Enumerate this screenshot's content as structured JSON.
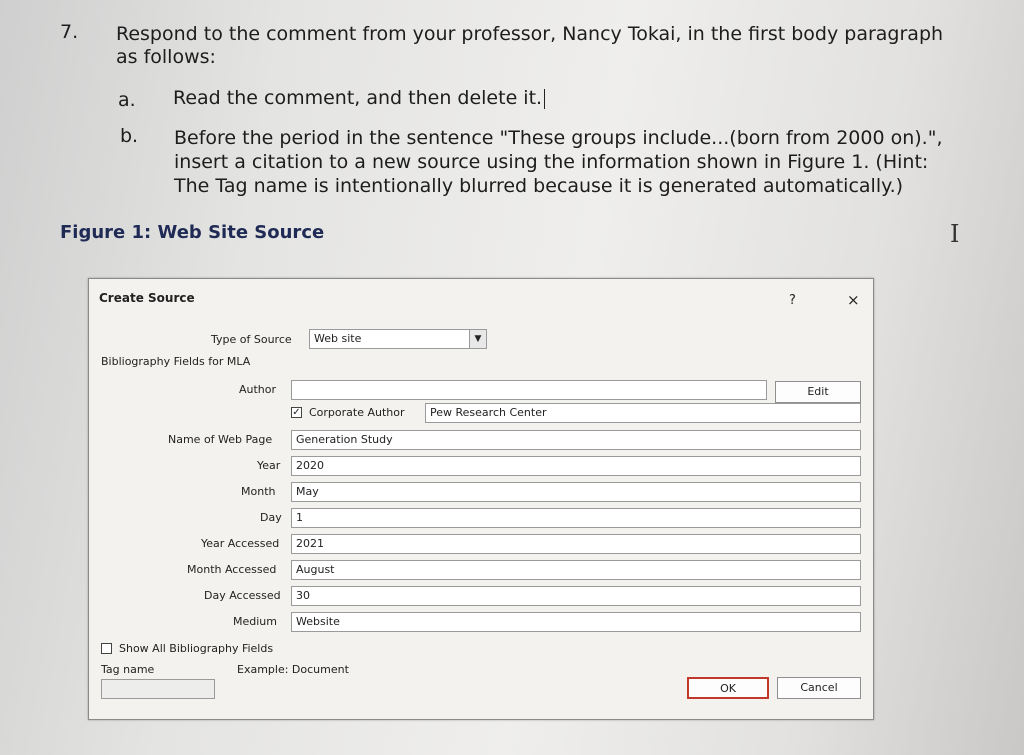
{
  "instructions": {
    "step_number": "7.",
    "step_line1": "Respond to the comment from your professor, Nancy Tokai, in the first body paragraph",
    "step_line2": "as follows:",
    "a_marker": "a.",
    "a_text": "Read the comment, and then delete it.",
    "b_marker": "b.",
    "b_line1": "Before the period in the sentence \"These groups include...(born from 2000 on).\",",
    "b_line2": "insert a citation to a new source using the information shown in Figure 1. (Hint:",
    "b_line3": "The Tag name is intentionally blurred because it is generated automatically.)",
    "figure_caption": "Figure 1: Web Site Source"
  },
  "dialog": {
    "title": "Create Source",
    "help_glyph": "?",
    "close_glyph": "×",
    "type_of_source_label": "Type of Source",
    "type_of_source_value": "Web site",
    "bibliography_fields_label": "Bibliography Fields for MLA",
    "author_label": "Author",
    "author_value": "",
    "edit_button": "Edit",
    "corporate_author_label": "Corporate Author",
    "corporate_author_value": "Pew Research Center",
    "fields": [
      {
        "label": "Name of Web Page",
        "value": "Generation Study"
      },
      {
        "label": "Year",
        "value": "2020"
      },
      {
        "label": "Month",
        "value": "May"
      },
      {
        "label": "Day",
        "value": "1"
      },
      {
        "label": "Year Accessed",
        "value": "2021"
      },
      {
        "label": "Month Accessed",
        "value": "August"
      },
      {
        "label": "Day Accessed",
        "value": "30"
      },
      {
        "label": "Medium",
        "value": "Website"
      }
    ],
    "show_all_label": "Show All Bibliography Fields",
    "tag_name_label": "Tag name",
    "tag_name_value": "",
    "example_label": "Example: Document",
    "ok_button": "OK",
    "cancel_button": "Cancel"
  }
}
